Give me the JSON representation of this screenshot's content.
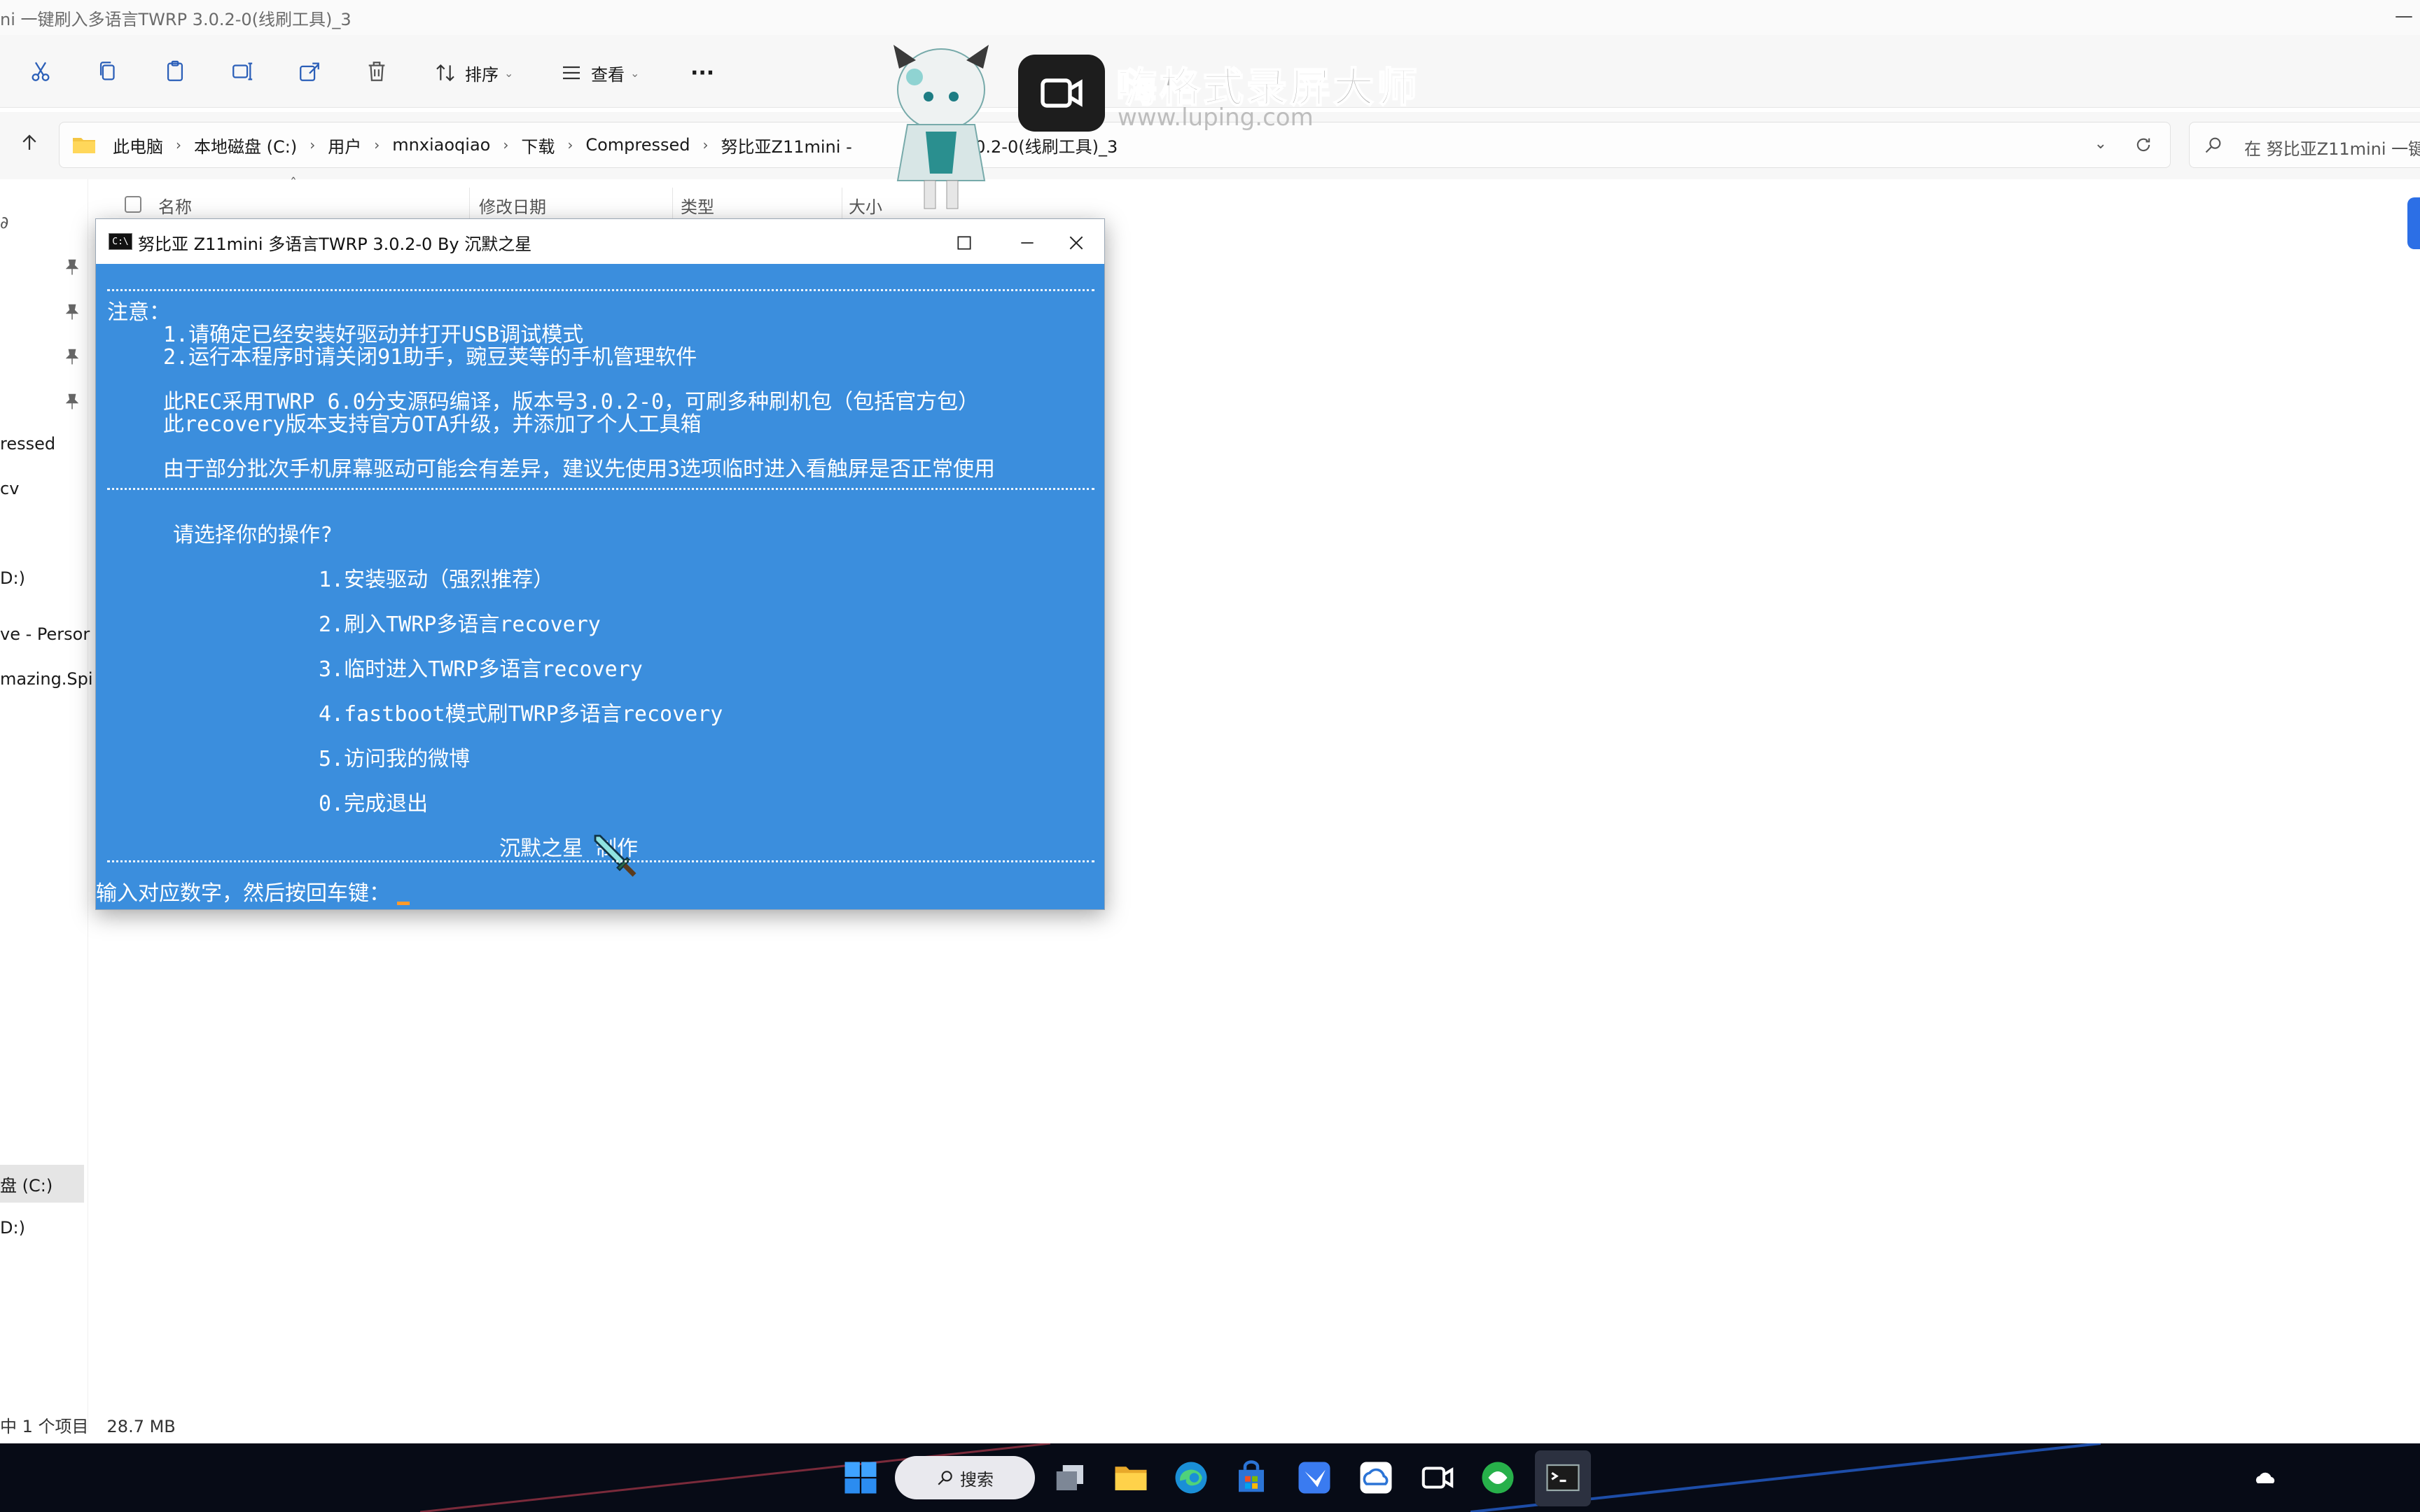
{
  "explorer": {
    "title": "ni 一键刷入多语言TWRP 3.0.2-0(线刷工具)_3",
    "toolbar": {
      "sort_label": "排序",
      "view_label": "查看",
      "more_label": "···"
    },
    "breadcrumbs": [
      "此电脑",
      "本地磁盘 (C:)",
      "用户",
      "mnxiaoqiao",
      "下载",
      "Compressed",
      "努比亚Z11mini - ",
      "WRP 3.0.2-0(线刷工具)_3"
    ],
    "search_placeholder": "在 努比亚Z11mini 一键",
    "columns": [
      "名称",
      "修改日期",
      "类型",
      "大小"
    ],
    "nav_items": [
      "ressed",
      "cv",
      "D:)",
      "ve - Persor",
      "mazing.Spi",
      "盘 (C:)",
      "D:)"
    ],
    "status": {
      "selected": "中 1 个项目",
      "size": "28.7 MB"
    }
  },
  "console": {
    "title": "努比亚 Z11mini 多语言TWRP 3.0.2-0 By 沉默之星",
    "icon_text": "C:\\",
    "lines": {
      "note": "注意：",
      "l1": "1.请确定已经安装好驱动并打开USB调试模式",
      "l2": "2.运行本程序时请关闭91助手，豌豆荚等的手机管理软件",
      "l3": "此REC采用TWRP 6.0分支源码编译，版本号3.0.2-0，可刷多种刷机包（包括官方包）",
      "l4": "此recovery版本支持官方OTA升级，并添加了个人工具箱",
      "l5": "由于部分批次手机屏幕驱动可能会有差异，建议先使用3选项临时进入看触屏是否正常使用",
      "prompt_title": "请选择你的操作?",
      "opt1": "1.安装驱动（强烈推荐）",
      "opt2": "2.刷入TWRP多语言recovery",
      "opt3": "3.临时进入TWRP多语言recovery",
      "opt4": "4.fastboot模式刷TWRP多语言recovery",
      "opt5": "5.访问我的微博",
      "opt0": "0.完成退出",
      "author": "沉默之星 制作",
      "input_prompt": "输入对应数字，然后按回车键："
    }
  },
  "watermark": {
    "name": "嗨格式录屏大师",
    "url": "www.luping.com"
  },
  "taskbar": {
    "search_label": "搜索"
  },
  "colors": {
    "console_bg": "#3b8edd",
    "taskbar_bg": "#070b16",
    "accent": "#2c6fe6"
  }
}
